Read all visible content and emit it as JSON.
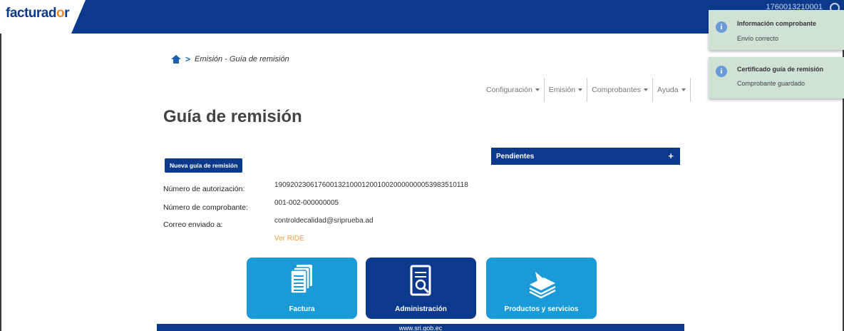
{
  "header": {
    "logo_prefix": "facturad",
    "logo_dot": "o",
    "logo_suffix": "r",
    "user_id": "1760013210001"
  },
  "breadcrumb": {
    "text": "Emisión - Guía de remisión"
  },
  "menu": [
    {
      "label": "Configuración"
    },
    {
      "label": "Emisión"
    },
    {
      "label": "Comprobantes"
    },
    {
      "label": "Ayuda"
    }
  ],
  "page_title": "Guía de remisión",
  "new_button": "Nueva guía de remisión",
  "pending": {
    "label": "Pendientes",
    "toggle": "+"
  },
  "details": {
    "auth_label": "Número de autorización:",
    "auth_value": "1909202306176001321000120010020000000053983510118",
    "voucher_label": "Número de comprobante:",
    "voucher_value": "001-002-000000005",
    "email_label": "Correo enviado a:",
    "email_value": "controldecalidad@sriprueba.ad",
    "ride_link": "Ver RIDE"
  },
  "tiles": [
    {
      "label": "Factura",
      "color": "#1a9ad6"
    },
    {
      "label": "Administración",
      "color": "#0b3a8c"
    },
    {
      "label": "Productos y servicios",
      "color": "#1a9ad6"
    }
  ],
  "footer": "www.sri.gob.ec",
  "toasts": [
    {
      "title": "Información comprobante",
      "message": "Envío correcto"
    },
    {
      "title": "Certificado guía de remisión",
      "message": "Comprobante guardado"
    }
  ]
}
